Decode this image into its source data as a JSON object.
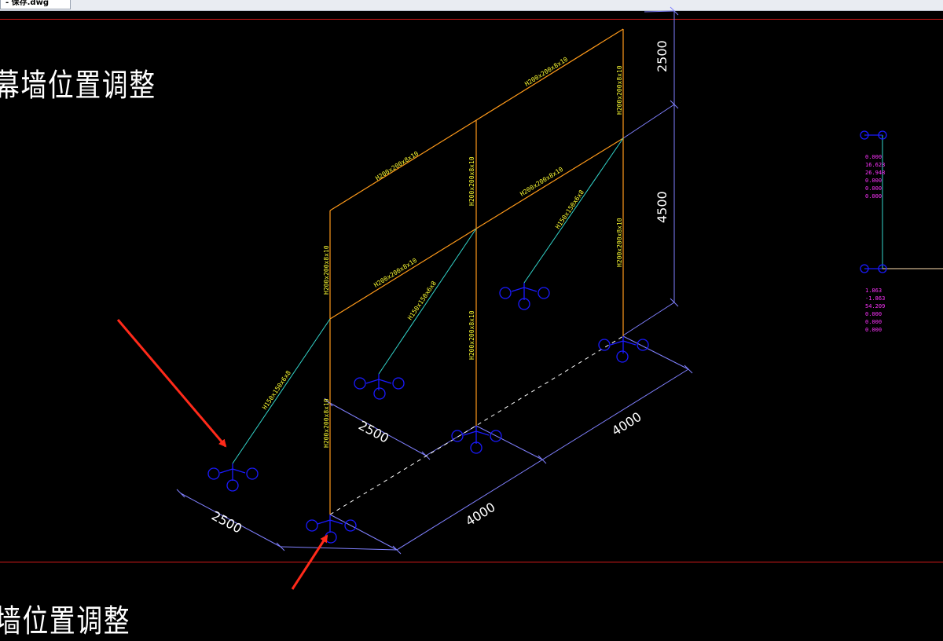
{
  "tab": {
    "label": "- 保存.dwg"
  },
  "titles": {
    "top": "幕墙位置调整",
    "bottom": "墙位置调整"
  },
  "dims": {
    "d2500_top": "2500",
    "d4500": "4500",
    "d2500_mid": "2500",
    "d4000_right": "4000",
    "d4000_bottom": "4000",
    "d2500_left": "2500"
  },
  "members": {
    "top_beam_left": "H200x200x8x10",
    "top_beam_right": "H200x200x8x10",
    "mid_beam_left": "H200x200x8x10",
    "mid_beam_right": "H200x200x8x10",
    "col_left_upper": "H200x200x8x10",
    "col_left_lower": "H200x200x8x10",
    "col_mid_upper": "H200x200x8x10",
    "col_mid_lower": "H200x200x8x10",
    "col_right_upper": "H200x200x8x10",
    "col_right_lower": "H200x200x8x10",
    "brace_left": "H150x150x6x8",
    "brace_mid": "H150x150x6x8",
    "brace_right": "H150x150x6x8"
  },
  "legend_values": {
    "upper": [
      "0.000",
      "16.623",
      "26.948",
      "0.000",
      "0.000",
      "0.000"
    ],
    "lower": [
      "1.863",
      "-1.863",
      "54.209",
      "0.000",
      "0.000",
      "0.000"
    ]
  },
  "colors": {
    "background": "#000000",
    "column": "#ff9a1a",
    "brace": "#33d6cc",
    "dimension": "#8080ff",
    "support": "#1a1aff",
    "label": "#ffff33",
    "legend": "#ff33ff",
    "border_line": "#d21a1a",
    "arrow": "#ff2a1a"
  }
}
